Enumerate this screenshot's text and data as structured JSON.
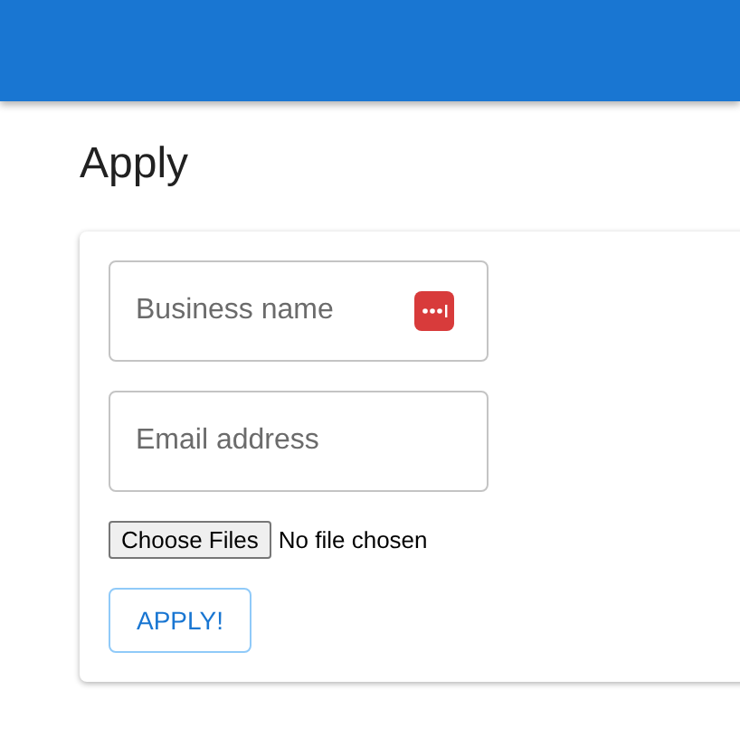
{
  "page_title": "Apply",
  "fields": [
    {
      "placeholder": "Business name",
      "password_manager_badge": true
    },
    {
      "placeholder": "Email address",
      "password_manager_badge": false
    }
  ],
  "file_picker": {
    "button": "Choose Files",
    "status": "No file chosen"
  },
  "submit_button": "APPLY!"
}
